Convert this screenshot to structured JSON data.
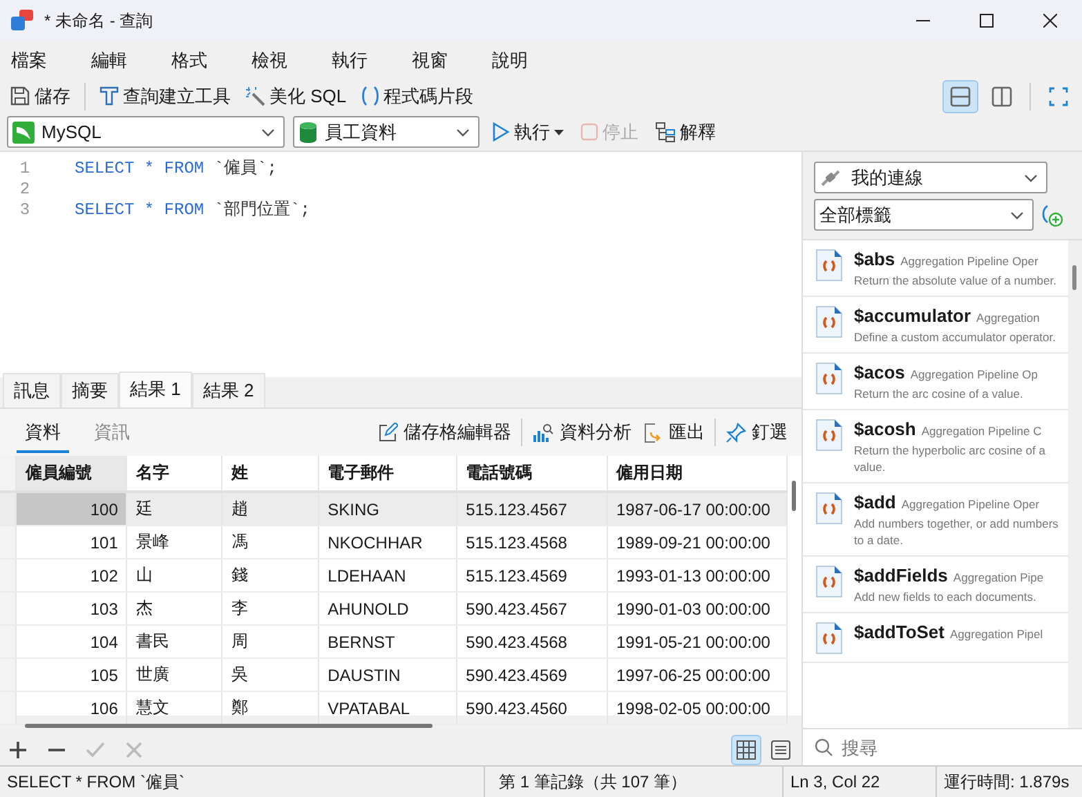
{
  "window": {
    "title": "* 未命名 - 查詢"
  },
  "menu": [
    "檔案",
    "編輯",
    "格式",
    "檢視",
    "執行",
    "視窗",
    "說明"
  ],
  "toolbar": {
    "save": "儲存",
    "query_builder": "查詢建立工具",
    "beautify": "美化 SQL",
    "snippets": "程式碼片段"
  },
  "layout_buttons": [
    {
      "kind": "stacked",
      "selected": true
    },
    {
      "kind": "side",
      "selected": false
    }
  ],
  "run_bar": {
    "connection": "MySQL",
    "database": "員工資料",
    "run": "執行",
    "stop": {
      "label": "停止",
      "disabled": true
    },
    "explain": "解釋"
  },
  "editor": {
    "lines": [
      {
        "number": "1",
        "tokens": [
          {
            "kind": "keyword",
            "text": "SELECT * FROM "
          },
          {
            "kind": "identifier",
            "text": "`僱員`;"
          }
        ]
      },
      {
        "number": "2"
      },
      {
        "number": "3",
        "tokens": [
          {
            "kind": "keyword",
            "text": "SELECT * FROM "
          },
          {
            "kind": "identifier",
            "text": "`部門位置`;"
          }
        ]
      }
    ]
  },
  "result_tabs": [
    {
      "label": "訊息",
      "selected": false
    },
    {
      "label": "摘要",
      "selected": false
    },
    {
      "label": "結果 1",
      "selected": true
    },
    {
      "label": "結果 2",
      "selected": false
    }
  ],
  "view_tabs": [
    {
      "label": "資料",
      "selected": true
    },
    {
      "label": "資訊",
      "selected": false
    }
  ],
  "result_actions": {
    "cell_editor": "儲存格編輯器",
    "analysis": "資料分析",
    "export": "匯出",
    "pin": "釘選"
  },
  "table": {
    "columns": [
      "僱員編號",
      "名字",
      "姓",
      "電子郵件",
      "電話號碼",
      "僱用日期"
    ],
    "rows": [
      {
        "selected": true,
        "cells": [
          "100",
          "廷",
          "趙",
          "SKING",
          "515.123.4567",
          "1987-06-17 00:00:00"
        ]
      },
      {
        "selected": false,
        "cells": [
          "101",
          "景峰",
          "馮",
          "NKOCHHAR",
          "515.123.4568",
          "1989-09-21 00:00:00"
        ]
      },
      {
        "selected": false,
        "cells": [
          "102",
          "山",
          "錢",
          "LDEHAAN",
          "515.123.4569",
          "1993-01-13 00:00:00"
        ]
      },
      {
        "selected": false,
        "cells": [
          "103",
          "杰",
          "李",
          "AHUNOLD",
          "590.423.4567",
          "1990-01-03 00:00:00"
        ]
      },
      {
        "selected": false,
        "cells": [
          "104",
          "書民",
          "周",
          "BERNST",
          "590.423.4568",
          "1991-05-21 00:00:00"
        ]
      },
      {
        "selected": false,
        "cells": [
          "105",
          "世廣",
          "吳",
          "DAUSTIN",
          "590.423.4569",
          "1997-06-25 00:00:00"
        ]
      },
      {
        "selected": false,
        "cells": [
          "106",
          "慧文",
          "鄭",
          "VPATABAL",
          "590.423.4560",
          "1998-02-05 00:00:00"
        ]
      }
    ]
  },
  "record_controls": [
    {
      "kind": "add",
      "disabled": false
    },
    {
      "kind": "remove",
      "disabled": false
    },
    {
      "kind": "apply",
      "disabled": true
    },
    {
      "kind": "discard",
      "disabled": true
    }
  ],
  "view_modes": [
    {
      "kind": "grid",
      "selected": true
    },
    {
      "kind": "form",
      "selected": false
    }
  ],
  "side_panel": {
    "connection": "我的連線",
    "tag_filter": "全部標籤",
    "snippets": [
      {
        "name": "$abs",
        "category": "Aggregation Pipeline Oper",
        "description": "Return the absolute value of a number."
      },
      {
        "name": "$accumulator",
        "category": "Aggregation",
        "description": "Define a custom accumulator operator."
      },
      {
        "name": "$acos",
        "category": "Aggregation Pipeline Op",
        "description": "Return the arc cosine of a value."
      },
      {
        "name": "$acosh",
        "category": "Aggregation Pipeline C",
        "description": "Return the hyperbolic arc cosine of a value."
      },
      {
        "name": "$add",
        "category": "Aggregation Pipeline Oper",
        "description": "Add numbers together, or add numbers to a date."
      },
      {
        "name": "$addFields",
        "category": "Aggregation Pipe",
        "description": "Add new fields to each documents."
      },
      {
        "name": "$addToSet",
        "category": "Aggregation Pipel"
      }
    ],
    "search": {
      "placeholder": "搜尋"
    }
  },
  "status_bar": {
    "query": "SELECT * FROM `僱員`",
    "records": "第 1 筆記錄（共 107 筆）",
    "position": "Ln 3, Col 22",
    "elapsed": "運行時間: 1.879s"
  }
}
